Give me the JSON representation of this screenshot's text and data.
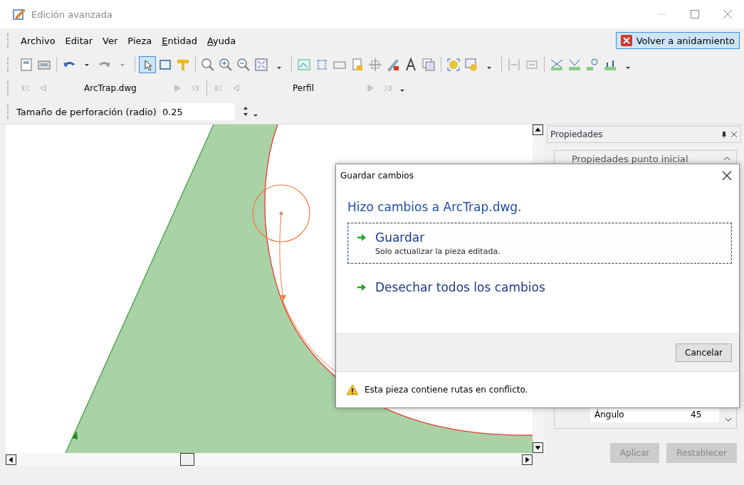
{
  "window": {
    "title": "Edición avanzada"
  },
  "menu": [
    {
      "label": "Archivo",
      "mnemonic": false
    },
    {
      "label": "Editar",
      "mnemonic": false
    },
    {
      "label": "Ver",
      "mnemonic": false
    },
    {
      "label": "Pieza",
      "mnemonic": false
    },
    {
      "label": "Entidad",
      "mnemonic": true
    },
    {
      "label": "Ayuda",
      "mnemonic": true
    }
  ],
  "return_button": {
    "label": "Volver a anidamiento"
  },
  "navigators": [
    {
      "label": "ArcTrap.dwg"
    },
    {
      "label": "Perfil"
    }
  ],
  "perforation": {
    "label": "Tamaño de perforación (radio)",
    "value": "0.25"
  },
  "properties": {
    "title": "Propiedades",
    "group": "Propiedades punto inicial",
    "rows": [
      {
        "name": "Ángulo",
        "value": "45"
      }
    ],
    "buttons": [
      {
        "label": "Aplicar",
        "disabled": true
      },
      {
        "label": "Restablecer",
        "disabled": true
      }
    ]
  },
  "dialog": {
    "title": "Guardar cambios",
    "heading": "Hizo cambios a ArcTrap.dwg.",
    "options": [
      {
        "label": "Guardar",
        "note": "Solo actualizar la pieza editada.",
        "focused": true
      },
      {
        "label": "Desechar todos los cambios",
        "focused": false
      }
    ],
    "cancel": "Cancelar",
    "warning": "Esta pieza contiene rutas en conflicto."
  }
}
